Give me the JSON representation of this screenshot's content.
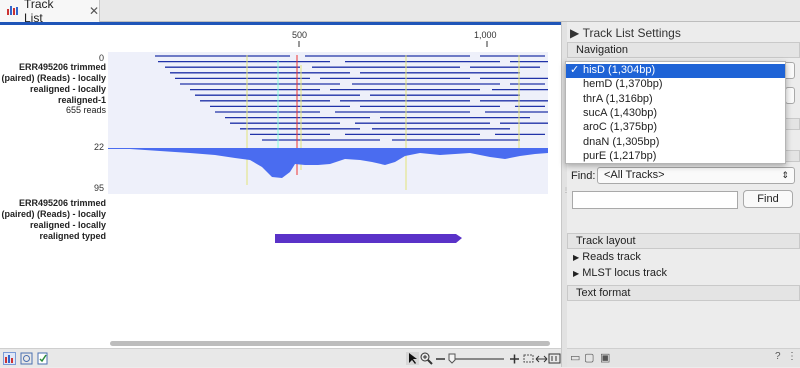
{
  "tab": {
    "label": "Track List",
    "close": "✕"
  },
  "ruler": {
    "ticks": [
      "500",
      "1,000"
    ]
  },
  "tracks": [
    {
      "label": "ERR495206 trimmed (paired) (Reads) - locally realigned - locally realigned-1",
      "reads": "655 reads",
      "axis": [
        "0",
        "22",
        "95"
      ]
    },
    {
      "label": "ERR495206 trimmed (paired) (Reads) - locally realigned - locally realigned typed"
    }
  ],
  "sidebar": {
    "title": "Track List Settings",
    "navigation": {
      "heading": "Navigation",
      "selected": "hisD (1,304bp)"
    },
    "find": {
      "label": "Find:",
      "scope": "<All Tracks>",
      "button": "Find",
      "query": ""
    },
    "track_layout": {
      "heading": "Track layout",
      "items": [
        "Reads track",
        "MLST locus track"
      ]
    },
    "text_format": {
      "heading": "Text format"
    }
  },
  "dropdown": {
    "options": [
      "hisD (1,304bp)",
      "hemD (1,370bp)",
      "thrA (1,316bp)",
      "sucA (1,430bp)",
      "aroC (1,375bp)",
      "dnaN (1,305bp)",
      "purE (1,217bp)"
    ],
    "selected_index": 0
  },
  "colors": {
    "coverage": "#4a6cf0",
    "read_line": "#2133a8",
    "gene": "#5a32c8",
    "selection": "#1e63d6",
    "accent_bar": "#1f55b8"
  }
}
